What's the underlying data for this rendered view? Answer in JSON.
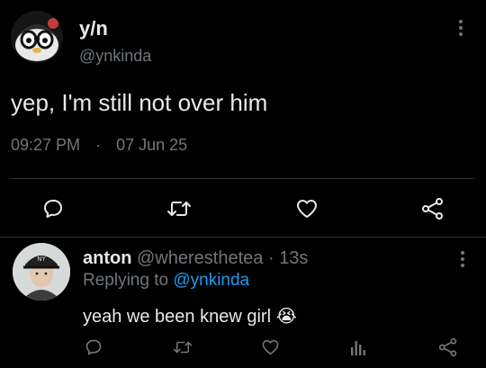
{
  "main_tweet": {
    "display_name": "y/n",
    "handle": "@ynkinda",
    "text": "yep, I'm still not over him",
    "time": "09:27 PM",
    "separator": "·",
    "date": "07 Jun 25"
  },
  "reply": {
    "display_name": "anton",
    "handle": "@wheresthetea",
    "separator": "·",
    "age": "13s",
    "replying_to_prefix": "Replying to",
    "replying_to_handle": "@ynkinda",
    "text": "yeah we been knew girl",
    "emoji": "😭"
  },
  "colors": {
    "background": "#000000",
    "primary_text": "#e7e9ea",
    "muted_text": "#71767b",
    "accent": "#1d9bf0",
    "divider": "#2f3336"
  },
  "icons": {
    "main_actions": [
      "reply-icon",
      "retweet-icon",
      "like-icon",
      "share-icon"
    ],
    "reply_actions": [
      "reply-icon",
      "retweet-icon",
      "like-icon",
      "views-icon",
      "share-icon"
    ]
  }
}
